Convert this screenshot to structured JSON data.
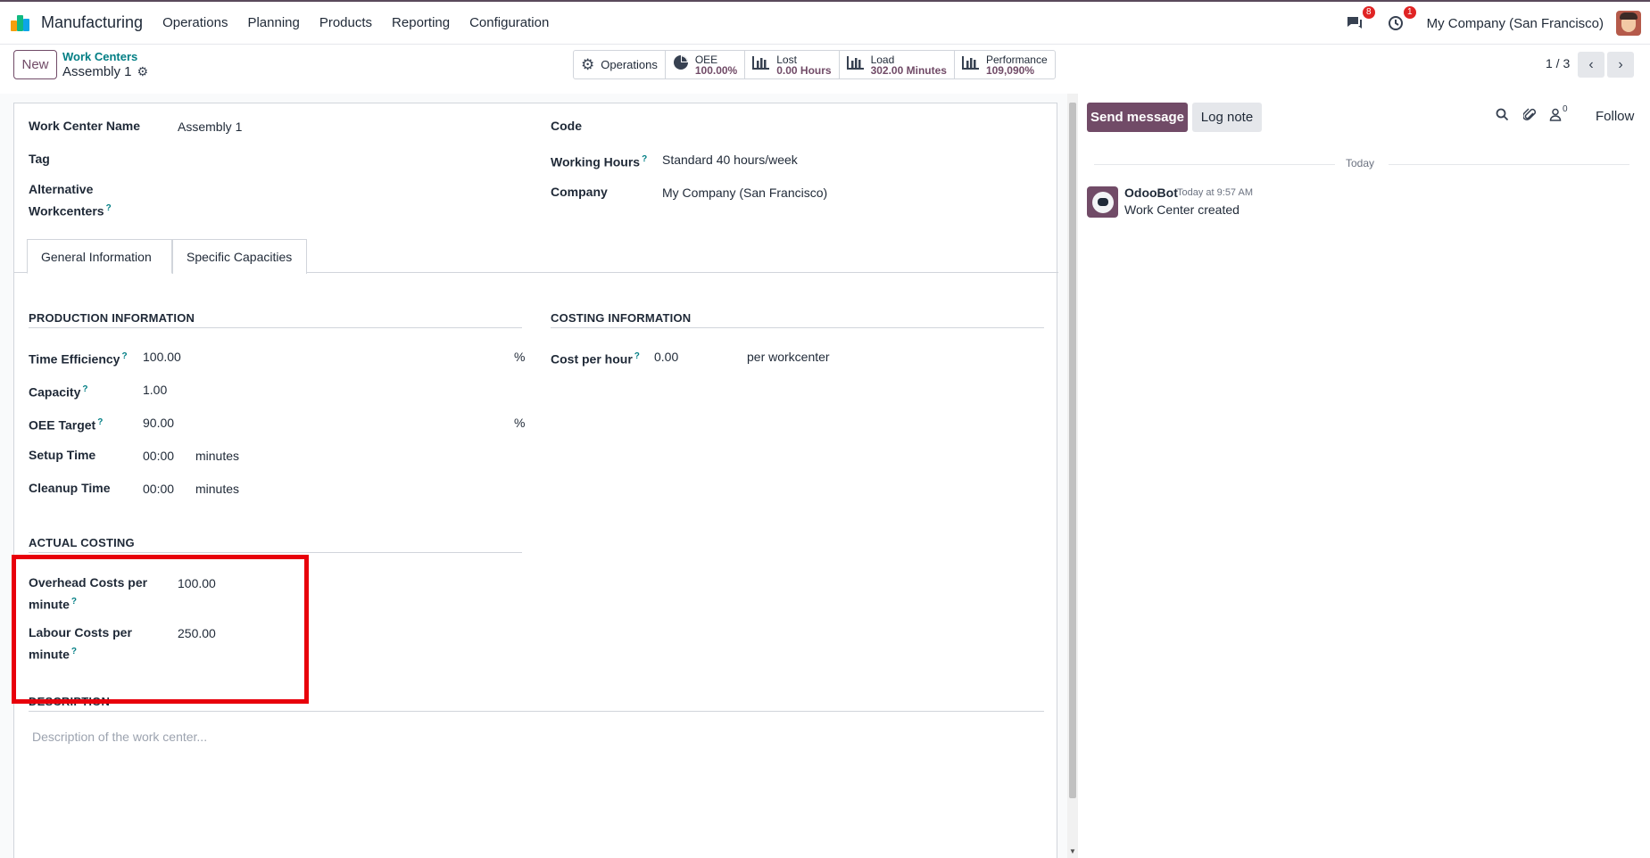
{
  "nav": {
    "app_title": "Manufacturing",
    "menu": [
      "Operations",
      "Planning",
      "Products",
      "Reporting",
      "Configuration"
    ],
    "messages_badge": "8",
    "activities_badge": "1",
    "company": "My Company (San Francisco)"
  },
  "control": {
    "new_label": "New",
    "breadcrumb": "Work Centers",
    "record_name": "Assembly 1",
    "stats": {
      "operations": "Operations",
      "oee_label": "OEE",
      "oee_value": "100.00%",
      "lost_label": "Lost",
      "lost_value": "0.00 Hours",
      "load_label": "Load",
      "load_value": "302.00 Minutes",
      "performance_label": "Performance",
      "performance_value": "109,090%"
    },
    "pager": "1 / 3"
  },
  "form": {
    "name_label": "Work Center Name",
    "name_value": "Assembly 1",
    "tag_label": "Tag",
    "alt_label_1": "Alternative",
    "alt_label_2": "Workcenters",
    "code_label": "Code",
    "hours_label": "Working Hours",
    "hours_value": "Standard 40 hours/week",
    "company_label": "Company",
    "company_value": "My Company (San Francisco)",
    "tabs": [
      "General Information",
      "Specific Capacities"
    ],
    "production_title": "Production Information",
    "costing_title": "Costing Information",
    "time_eff_label": "Time Efficiency",
    "time_eff_value": "100.00",
    "capacity_label": "Capacity",
    "capacity_value": "1.00",
    "oee_target_label": "OEE Target",
    "oee_target_value": "90.00",
    "percent": "%",
    "setup_label": "Setup Time",
    "setup_value": "00:00",
    "cleanup_label": "Cleanup Time",
    "cleanup_value": "00:00",
    "minutes": "minutes",
    "cost_hour_label": "Cost per hour",
    "cost_hour_value": "0.00",
    "per_workcenter": "per workcenter",
    "actual_costing_title": "Actual Costing",
    "overhead_label_1": "Overhead Costs per",
    "overhead_label_2": "minute",
    "overhead_value": "100.00",
    "labour_label_1": "Labour Costs per",
    "labour_label_2": "minute",
    "labour_value": "250.00",
    "description_title": "Description",
    "description_placeholder": "Description of the work center..."
  },
  "chatter": {
    "send_message": "Send message",
    "log_note": "Log note",
    "followers_count": "0",
    "follow": "Follow",
    "today": "Today",
    "author": "OdooBot",
    "time": "Today at 9:57 AM",
    "body": "Work Center created"
  },
  "colors": {
    "brand": "#714b67",
    "link": "#017e84",
    "highlight": "#e8000b",
    "badge": "#e02424"
  }
}
